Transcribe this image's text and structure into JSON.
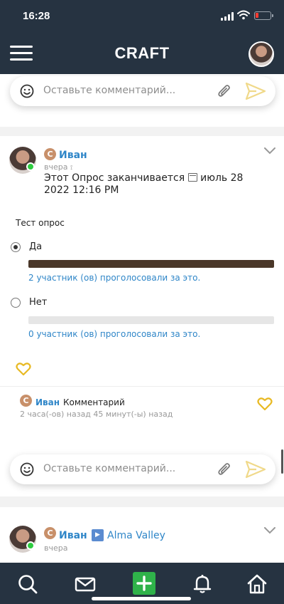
{
  "status_bar": {
    "time": "16:28"
  },
  "header": {
    "title": "CRAFT"
  },
  "comment_input": {
    "placeholder": "Оставьте комментарий..."
  },
  "post1": {
    "badge": "C",
    "author": "Иван",
    "time": "вчера",
    "text_prefix": "Этот Опрос заканчивается",
    "text_date": "июль 28 2022 12:16 PM",
    "poll": {
      "title": "Тест опрос",
      "options": [
        {
          "label": "Да",
          "selected": true,
          "fill": 1.0,
          "votes": "2 участник (ов) проголосовали за это."
        },
        {
          "label": "Нет",
          "selected": false,
          "fill": 0.0,
          "votes": "0 участник (ов) проголосовали за это."
        }
      ]
    },
    "comment": {
      "badge": "C",
      "author": "Иван",
      "text": "Комментарий",
      "time": "2 часа(-ов) назад 45 минут(-ы) назад"
    }
  },
  "post2": {
    "badge": "C",
    "author": "Иван",
    "group": "Alma Valley",
    "time": "вчера"
  },
  "colors": {
    "header_bg": "#263341",
    "link_blue": "#2f86c8",
    "heart_gold": "#e8b923",
    "poll_fill": "#4a3729",
    "add_green": "#2fb24a"
  }
}
